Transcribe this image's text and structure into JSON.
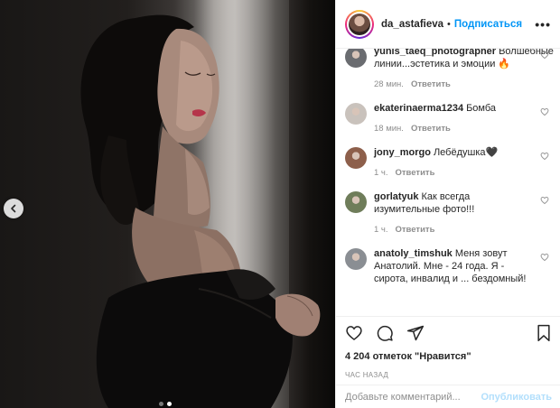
{
  "post": {
    "author": "da_astafieva",
    "separator": "•",
    "follow_label": "Подписаться",
    "more_icon": "more-dots-icon",
    "carousel": {
      "slide_count": 2,
      "active_index": 1
    },
    "likes_text": "4 204 отметок \"Нравится\"",
    "time_text": "ЧАС НАЗАД"
  },
  "comments": [
    {
      "user": "yunis_taeq_photographer",
      "text": "Волшебные линии...эстетика и эмоции 🔥",
      "time": "28 мин.",
      "reply": "Ответить",
      "avatar_color": "#6a6c70"
    },
    {
      "user": "ekaterinaerma1234",
      "text": "Бомба",
      "time": "18 мин.",
      "reply": "Ответить",
      "avatar_color": "#c9c2bc"
    },
    {
      "user": "jony_morgo",
      "text": "Лебёдушка🖤",
      "time": "1 ч.",
      "reply": "Ответить",
      "avatar_color": "#8d5f4b"
    },
    {
      "user": "gorlatyuk",
      "text": "Как всегда изумительные фото!!!",
      "time": "1 ч.",
      "reply": "Ответить",
      "avatar_color": "#6f7d5a"
    },
    {
      "user": "anatoly_timshuk",
      "text": "Меня зовут Анатолий. Мне - 24 года. Я - сирота, инвалид и ... бездомный!",
      "time": "",
      "reply": "",
      "avatar_color": "#8a8e93"
    }
  ],
  "add_comment": {
    "placeholder": "Добавьте комментарий...",
    "publish_label": "Опубликовать"
  }
}
